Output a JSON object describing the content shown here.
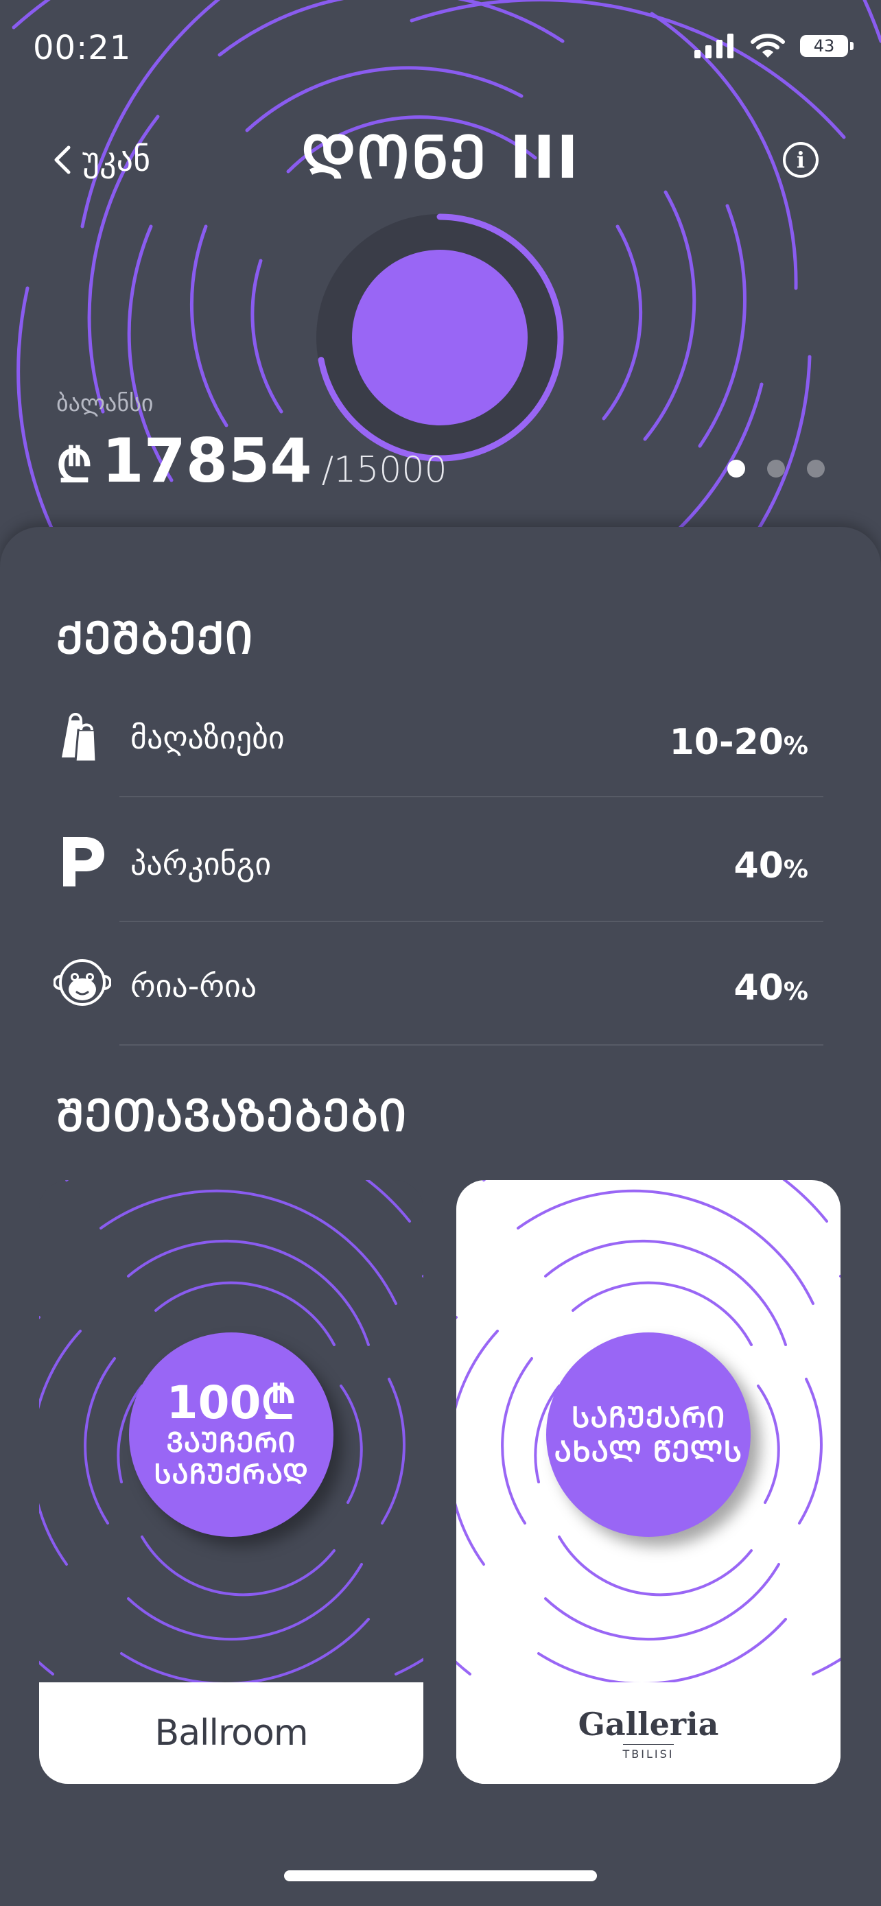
{
  "status_bar": {
    "time": "00:21",
    "battery": "43"
  },
  "nav": {
    "back_label": "უკან",
    "title": "ᲓᲝᲜᲔ III",
    "info_label": "i"
  },
  "level": {
    "progress": 0.72
  },
  "balance": {
    "label": "ბალანსი",
    "currency_symbol": "₾",
    "value": "17854",
    "max": "/15000"
  },
  "pager": {
    "count": 3,
    "active": 0
  },
  "cashback": {
    "title": "ᲥᲔᲨᲑᲔᲥᲘ",
    "items": [
      {
        "icon": "shopping-bags-icon",
        "label": "მაღაზიები",
        "value": "10-20",
        "unit": "%"
      },
      {
        "icon": "parking-icon",
        "label": "პარკინგი",
        "value": "40",
        "unit": "%"
      },
      {
        "icon": "monkey-icon",
        "label": "რია-რია",
        "value": "40",
        "unit": "%"
      }
    ]
  },
  "offers": {
    "title": "ᲨᲔᲗᲐᲕᲐᲖᲔᲑᲔᲑᲘ",
    "cards": [
      {
        "badge_line1": "100₾",
        "badge_line2": "ᲕᲐᲣᲩᲔᲠᲘ",
        "badge_line3": "ᲡᲐᲩᲣᲥᲠᲐᲓ",
        "brand": "Ballroom"
      },
      {
        "badge_line1": "ᲡᲐᲩᲣᲥᲐᲠᲘ",
        "badge_line2": "ᲐᲮᲐᲚ ᲬᲔᲚᲡ",
        "brand": "Galleria",
        "brand_sub": "TBILISI"
      }
    ]
  },
  "colors": {
    "accent": "#9966f5",
    "background": "#454955",
    "white": "#ffffff"
  }
}
